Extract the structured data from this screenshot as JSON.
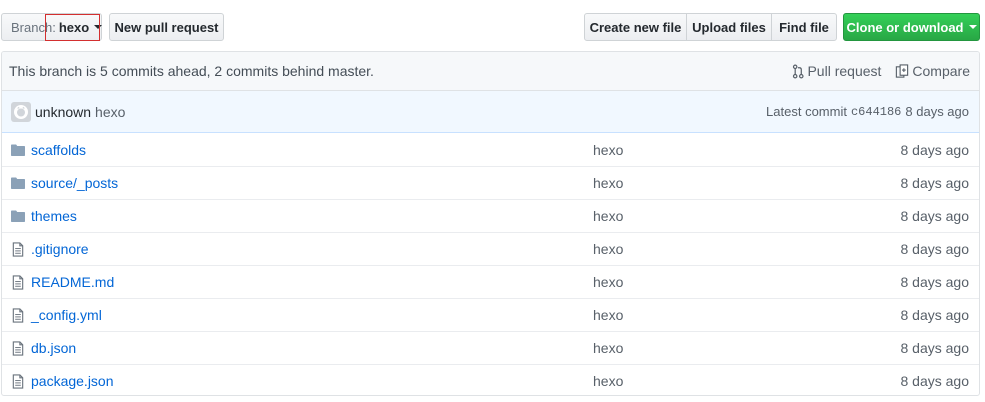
{
  "branch": {
    "prefix": "Branch:",
    "name": "hexo"
  },
  "buttons": {
    "new_pull_request": "New pull request",
    "create_new_file": "Create new file",
    "upload_files": "Upload files",
    "find_file": "Find file",
    "clone_or_download": "Clone or download"
  },
  "tracking": {
    "message": "This branch is 5 commits ahead, 2 commits behind master.",
    "pull_request": "Pull request",
    "compare": "Compare"
  },
  "latest_commit": {
    "author": "unknown",
    "message": "hexo",
    "label": "Latest commit",
    "sha": "c644186",
    "age": "8 days ago"
  },
  "files": [
    {
      "type": "folder",
      "icon": "folder-icon",
      "name": "scaffolds",
      "message": "hexo",
      "age": "8 days ago"
    },
    {
      "type": "folder",
      "icon": "folder-icon",
      "name": "source/_posts",
      "message": "hexo",
      "age": "8 days ago"
    },
    {
      "type": "folder",
      "icon": "folder-icon",
      "name": "themes",
      "message": "hexo",
      "age": "8 days ago"
    },
    {
      "type": "file",
      "icon": "file-icon",
      "name": ".gitignore",
      "message": "hexo",
      "age": "8 days ago"
    },
    {
      "type": "file",
      "icon": "file-icon",
      "name": "README.md",
      "message": "hexo",
      "age": "8 days ago"
    },
    {
      "type": "file",
      "icon": "file-icon",
      "name": "_config.yml",
      "message": "hexo",
      "age": "8 days ago"
    },
    {
      "type": "file",
      "icon": "file-icon",
      "name": "db.json",
      "message": "hexo",
      "age": "8 days ago"
    },
    {
      "type": "file",
      "icon": "file-icon",
      "name": "package.json",
      "message": "hexo",
      "age": "8 days ago"
    }
  ],
  "colors": {
    "link": "#0366d6",
    "clone_green": "#2cbe4e",
    "highlight": "#d32f2f"
  }
}
